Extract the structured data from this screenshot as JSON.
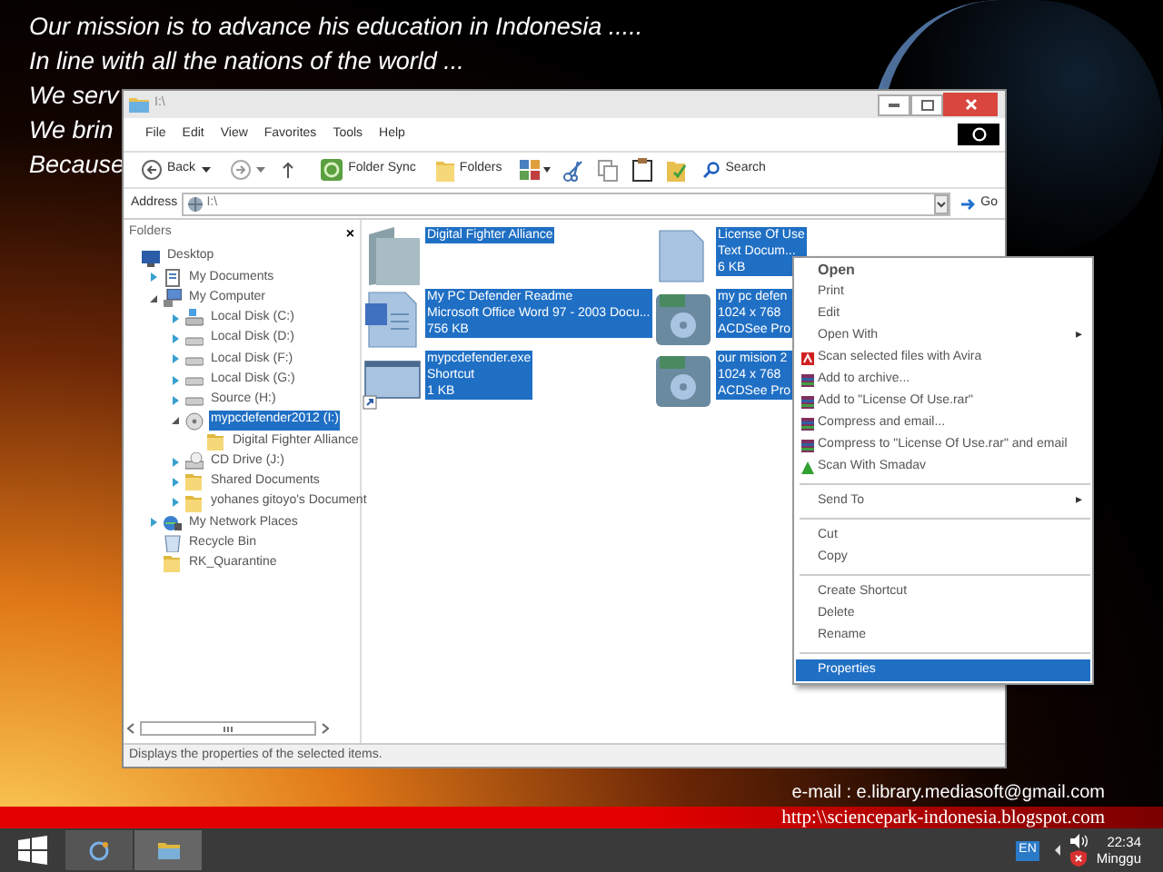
{
  "desktop_text": {
    "lines": [
      "Our mission is to advance his education in Indonesia .....",
      "In line with all the nations of the world ...",
      "We serv",
      "We brin",
      "Because"
    ]
  },
  "window": {
    "title": "I:\\"
  },
  "menu_bar": [
    "File",
    "Edit",
    "View",
    "Favorites",
    "Tools",
    "Help"
  ],
  "toolbar": {
    "back": "Back",
    "folder_sync": "Folder Sync",
    "folders": "Folders",
    "search": "Search"
  },
  "address_bar": {
    "label": "Address",
    "value": "I:\\",
    "go": "Go"
  },
  "folder_pane": {
    "title": "Folders",
    "close": "×",
    "tree": [
      {
        "label": "Desktop",
        "kind": "desktop",
        "selected": false,
        "children": [
          {
            "label": "My Documents",
            "kind": "documents",
            "selected": false,
            "expanded": false
          },
          {
            "label": "My Computer",
            "kind": "computer",
            "selected": false,
            "expanded": true,
            "children": [
              {
                "label": "Local Disk (C:)",
                "kind": "system-drive",
                "selected": false,
                "expanded": false
              },
              {
                "label": "Local Disk (D:)",
                "kind": "drive",
                "selected": false,
                "expanded": false
              },
              {
                "label": "Local Disk (F:)",
                "kind": "drive",
                "selected": false,
                "expanded": false
              },
              {
                "label": "Local Disk (G:)",
                "kind": "drive",
                "selected": false,
                "expanded": false
              },
              {
                "label": "Source  (H:)",
                "kind": "drive",
                "selected": false,
                "expanded": false
              },
              {
                "label": "mypcdefender2012 (I:)",
                "kind": "disc",
                "selected": true,
                "expanded": true,
                "children": [
                  {
                    "label": "Digital Fighter Alliance",
                    "kind": "folder",
                    "selected": false
                  }
                ]
              },
              {
                "label": "CD Drive (J:)",
                "kind": "cd",
                "selected": false,
                "expanded": false
              },
              {
                "label": "Shared Documents",
                "kind": "folder",
                "selected": false,
                "expanded": false
              },
              {
                "label": "yohanes gitoyo's Document",
                "kind": "folder",
                "selected": false,
                "expanded": false
              }
            ]
          },
          {
            "label": "My Network Places",
            "kind": "network",
            "selected": false,
            "expanded": false
          },
          {
            "label": "Recycle Bin",
            "kind": "recycle",
            "selected": false
          },
          {
            "label": "RK_Quarantine",
            "kind": "folder",
            "selected": false
          }
        ]
      }
    ]
  },
  "files": [
    {
      "kind": "folder",
      "lines": [
        "Digital Fighter Alliance"
      ],
      "selected": true
    },
    {
      "kind": "text",
      "lines": [
        "License Of Use",
        "Text Docum...",
        "6 KB"
      ],
      "selected": true
    },
    {
      "kind": "word",
      "lines": [
        "My PC Defender Readme",
        "Microsoft Office Word 97 - 2003 Docu...",
        "756 KB"
      ],
      "selected": true
    },
    {
      "kind": "jpg",
      "lines": [
        "my pc defen",
        "1024 x 768",
        "ACDSee Pro"
      ],
      "selected": true
    },
    {
      "kind": "shortcut",
      "lines": [
        "mypcdefender.exe",
        "Shortcut",
        "1 KB"
      ],
      "selected": true
    },
    {
      "kind": "jpg",
      "lines": [
        "our mision 2",
        "1024 x 768",
        "ACDSee Pro"
      ],
      "selected": true
    }
  ],
  "context_menu": [
    {
      "kind": "item",
      "label": "Open",
      "default": true,
      "selected": false
    },
    {
      "kind": "item",
      "label": "Print",
      "default": false,
      "selected": false
    },
    {
      "kind": "item",
      "label": "Edit",
      "default": false,
      "selected": false
    },
    {
      "kind": "submenu",
      "label": "Open With",
      "arrow": "▸",
      "default": false,
      "selected": false
    },
    {
      "kind": "avira",
      "label": "Scan selected files with Avira",
      "default": false,
      "selected": false
    },
    {
      "kind": "archive",
      "label": "Add to archive...",
      "default": false,
      "selected": false
    },
    {
      "kind": "archive",
      "label": "Add to \"License Of Use.rar\"",
      "default": false,
      "selected": false
    },
    {
      "kind": "archive",
      "label": "Compress and email...",
      "default": false,
      "selected": false
    },
    {
      "kind": "archive",
      "label": "Compress to \"License Of Use.rar\" and email",
      "default": false,
      "selected": false
    },
    {
      "kind": "smadav",
      "label": "Scan With Smadav",
      "default": false,
      "selected": false
    },
    {
      "kind": "separator"
    },
    {
      "kind": "submenu",
      "label": "Send To",
      "arrow": "▸",
      "default": false,
      "selected": false
    },
    {
      "kind": "separator"
    },
    {
      "kind": "item",
      "label": "Cut",
      "default": false,
      "selected": false
    },
    {
      "kind": "item",
      "label": "Copy",
      "default": false,
      "selected": false
    },
    {
      "kind": "separator"
    },
    {
      "kind": "item",
      "label": "Create Shortcut",
      "default": false,
      "selected": false
    },
    {
      "kind": "item",
      "label": "Delete",
      "default": false,
      "selected": false
    },
    {
      "kind": "item",
      "label": "Rename",
      "default": false,
      "selected": false
    },
    {
      "kind": "separator"
    },
    {
      "kind": "item",
      "label": "Properties",
      "default": false,
      "selected": true
    }
  ],
  "status_bar": "Displays the properties of the selected items.",
  "footer": {
    "email": "e-mail : e.library.mediasoft@gmail.com",
    "url": "http:\\\\sciencepark-indonesia.blogspot.com"
  },
  "taskbar": {
    "language": "EN",
    "time": "22:34",
    "day": "Minggu"
  }
}
